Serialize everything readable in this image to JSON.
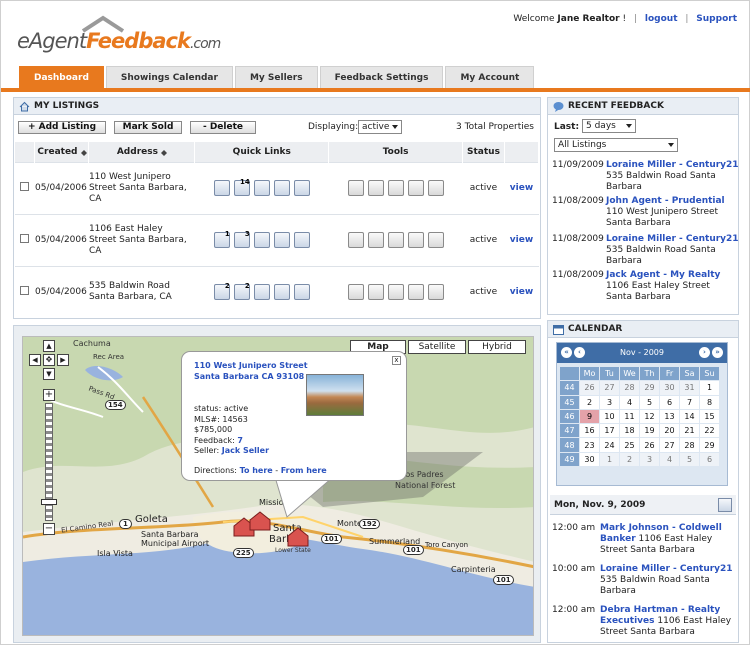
{
  "brand": {
    "logo_e": "e",
    "logo_agent": "Agent",
    "logo_feedback": "Feedback",
    "logo_com": ".com"
  },
  "header": {
    "welcome": "Welcome",
    "user": "Jane Realtor",
    "separator": "!",
    "logout": "logout",
    "support": "Support"
  },
  "tabs": [
    "Dashboard",
    "Showings Calendar",
    "My Sellers",
    "Feedback Settings",
    "My Account"
  ],
  "listings": {
    "title": "MY LISTINGS",
    "buttons": {
      "add": "+ Add Listing",
      "sold": "Mark Sold",
      "delete": "- Delete"
    },
    "displaying_label": "Displaying:",
    "displaying_value": "active",
    "total": "3 Total Properties",
    "columns": [
      "Created",
      "Address",
      "Quick Links",
      "Tools",
      "Status"
    ],
    "rows": [
      {
        "created": "05/04/2006",
        "address": "110 West Junipero Street Santa Barbara, CA",
        "badges": [
          "",
          "14",
          "",
          "",
          ""
        ],
        "status": "active",
        "view": "view"
      },
      {
        "created": "05/04/2006",
        "address": "1106 East Haley Street Santa Barbara, CA",
        "badges": [
          "1",
          "3",
          "",
          "",
          ""
        ],
        "status": "active",
        "view": "view"
      },
      {
        "created": "05/04/2006",
        "address": "535 Baldwin Road Santa Barbara, CA",
        "badges": [
          "2",
          "2",
          "",
          "",
          ""
        ],
        "status": "active",
        "view": "view"
      }
    ]
  },
  "map": {
    "buttons": [
      "Map",
      "Satellite",
      "Hybrid"
    ],
    "labels": [
      "Cachuma",
      "Rec Area",
      "Pass Rd",
      "154",
      "Los Padres",
      "National Forest",
      "Goleta",
      "Santa Barbara",
      "Municipal Airport",
      "Isla Vista",
      "El Camino Real",
      "Montecito",
      "Summerland",
      "Toro Canyon",
      "Carpinteria",
      "101",
      "192",
      "225",
      "1",
      "Missio",
      "Santa",
      "Barb",
      "Lower State"
    ],
    "popup": {
      "street": "110 West Junipero Street",
      "city": "Santa Barbara CA 93108",
      "status": "status: active",
      "mls": "MLS#: 14563",
      "price": "$785,000",
      "feedback_label": "Feedback:",
      "feedback_value": "7",
      "seller_label": "Seller:",
      "seller_value": "Jack Seller",
      "directions_label": "Directions:",
      "to_here": "To here",
      "dash": "-",
      "from_here": "From here",
      "close": "x"
    }
  },
  "recent": {
    "title": "RECENT FEEDBACK",
    "last_label": "Last:",
    "last_value": "5 days",
    "listing_value": "All Listings",
    "items": [
      {
        "date": "11/09/2009",
        "who": "Loraine Miller - Century21",
        "addr": "535 Baldwin Road Santa Barbara"
      },
      {
        "date": "11/08/2009",
        "who": "John Agent - Prudential",
        "addr": "110 West Junipero Street Santa Barbara"
      },
      {
        "date": "11/08/2009",
        "who": "Loraine Miller - Century21",
        "addr": "535 Baldwin Road Santa Barbara"
      },
      {
        "date": "11/08/2009",
        "who": "Jack Agent - My Realty",
        "addr": "1106 East Haley Street Santa Barbara"
      }
    ]
  },
  "calendar": {
    "title": "CALENDAR",
    "month": "Nov - 2009",
    "dow": [
      "",
      "Mo",
      "Tu",
      "We",
      "Th",
      "Fr",
      "Sa",
      "Su"
    ],
    "weeks": [
      [
        "44",
        "26",
        "27",
        "28",
        "29",
        "30",
        "31",
        "1"
      ],
      [
        "45",
        "2",
        "3",
        "4",
        "5",
        "6",
        "7",
        "8"
      ],
      [
        "46",
        "9",
        "10",
        "11",
        "12",
        "13",
        "14",
        "15"
      ],
      [
        "47",
        "16",
        "17",
        "18",
        "19",
        "20",
        "21",
        "22"
      ],
      [
        "48",
        "23",
        "24",
        "25",
        "26",
        "27",
        "28",
        "29"
      ],
      [
        "49",
        "30",
        "1",
        "2",
        "3",
        "4",
        "5",
        "6"
      ]
    ],
    "day_title": "Mon, Nov. 9, 2009",
    "appointments": [
      {
        "time": "12:00 am",
        "who": "Mark Johnson - Coldwell Banker",
        "addr": "1106 East Haley Street Santa Barbara"
      },
      {
        "time": "10:00 am",
        "who": "Loraine Miller - Century21",
        "addr": "535 Baldwin Road Santa Barbara"
      },
      {
        "time": "12:00 am",
        "who": "Debra Hartman - Realty Executives",
        "addr": "1106 East Haley Street Santa Barbara"
      }
    ]
  },
  "colors": {
    "accent": "#e8791e",
    "link": "#2a52be",
    "calendar_header": "#3f6da6"
  }
}
